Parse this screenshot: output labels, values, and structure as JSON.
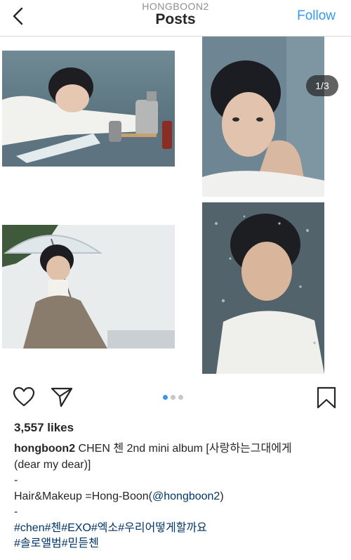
{
  "header": {
    "username": "HONGBOON2",
    "title": "Posts",
    "follow_label": "Follow"
  },
  "post": {
    "image_counter": "1/3",
    "carousel": {
      "total": 3,
      "active_index": 0
    },
    "likes": "3,557 likes",
    "caption": {
      "username": "hongboon2",
      "text_line1": " CHEN 첸 2nd mini album [사랑하는그대에게",
      "text_line2": "(dear my dear)]",
      "dash1": "-",
      "credit_prefix": "Hair&Makeup =Hong-Boon(",
      "credit_mention": "@hongboon2",
      "credit_suffix": ")",
      "dash2": "-",
      "hashtags_line1": "#chen#첸#EXO#엑소#우리어떻게할까요",
      "hashtags_line2": "#솔로앨범#믿듣첸"
    }
  },
  "icons": {
    "back": "chevron-left-icon",
    "like": "heart-outline-icon",
    "share": "paper-plane-icon",
    "save": "bookmark-outline-icon"
  },
  "colors": {
    "accent": "#3897f0",
    "text": "#262626",
    "muted": "#8e8e8e",
    "link": "#003569",
    "divider": "#dbdbdb"
  }
}
